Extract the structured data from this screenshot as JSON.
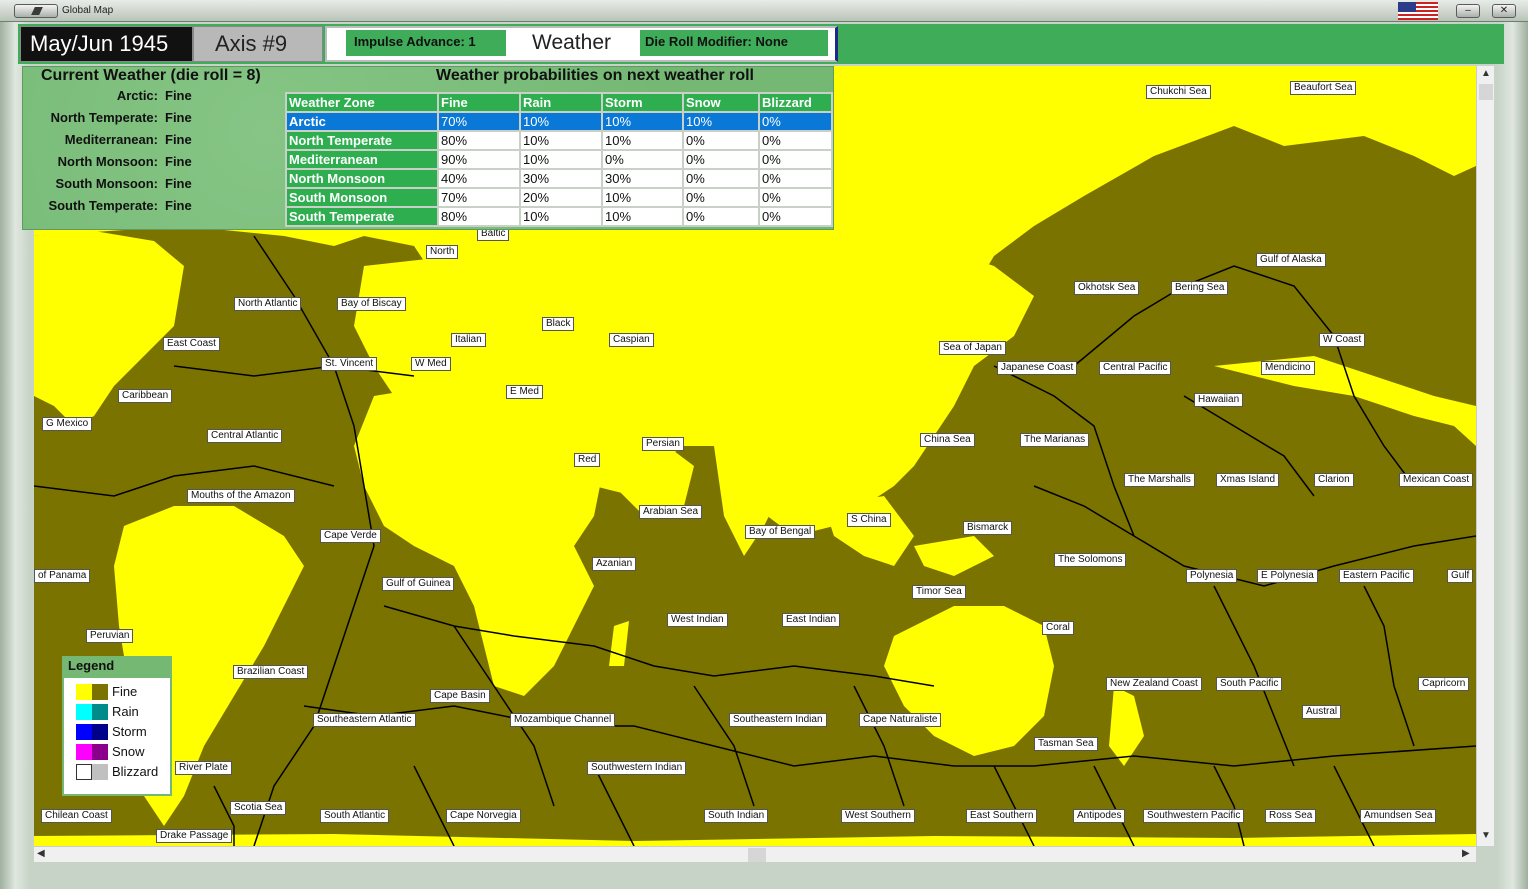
{
  "window": {
    "title": "Global Map"
  },
  "header": {
    "date": "May/Jun 1945",
    "axis": "Axis #9",
    "impulse_advance": "Impulse Advance:  1",
    "weather_label": "Weather",
    "die_roll_modifier": "Die Roll Modifier:  None"
  },
  "current_weather": {
    "title": "Current Weather (die roll = 8)",
    "zones": [
      {
        "name": "Arctic:",
        "value": "Fine"
      },
      {
        "name": "North Temperate:",
        "value": "Fine"
      },
      {
        "name": "Mediterranean:",
        "value": "Fine"
      },
      {
        "name": "North Monsoon:",
        "value": "Fine"
      },
      {
        "name": "South Monsoon:",
        "value": "Fine"
      },
      {
        "name": "South Temperate:",
        "value": "Fine"
      }
    ]
  },
  "probabilities": {
    "title": "Weather probabilities on next weather roll",
    "headers": [
      "Weather Zone",
      "Fine",
      "Rain",
      "Storm",
      "Snow",
      "Blizzard"
    ],
    "rows": [
      [
        "Arctic",
        "70%",
        "10%",
        "10%",
        "10%",
        "0%"
      ],
      [
        "North Temperate",
        "80%",
        "10%",
        "10%",
        "0%",
        "0%"
      ],
      [
        "Mediterranean",
        "90%",
        "10%",
        "0%",
        "0%",
        "0%"
      ],
      [
        "North Monsoon",
        "40%",
        "30%",
        "30%",
        "0%",
        "0%"
      ],
      [
        "South Monsoon",
        "70%",
        "20%",
        "10%",
        "0%",
        "0%"
      ],
      [
        "South Temperate",
        "80%",
        "10%",
        "10%",
        "0%",
        "0%"
      ]
    ],
    "selected_row": "Arctic"
  },
  "legend": {
    "title": "Legend",
    "items": [
      {
        "label": "Fine",
        "land": "#ffff00",
        "sea": "#7a7300"
      },
      {
        "label": "Rain",
        "land": "#00ffff",
        "sea": "#008b8b"
      },
      {
        "label": "Storm",
        "land": "#0000ff",
        "sea": "#00008b"
      },
      {
        "label": "Snow",
        "land": "#ff00ff",
        "sea": "#8b008b"
      },
      {
        "label": "Blizzard",
        "land": "#ffffff",
        "sea": "#c0c0c0"
      }
    ]
  },
  "sea_areas": [
    "Chukchi Sea",
    "Beaufort Sea",
    "Baltic",
    "North",
    "North Atlantic",
    "Bay of Biscay",
    "Black",
    "Caspian",
    "Italian",
    "East Coast",
    "St. Vincent",
    "W Med",
    "E Med",
    "Caribbean",
    "G Mexico",
    "Central Atlantic",
    "Red",
    "Persian",
    "Mouths of the Amazon",
    "Arabian Sea",
    "Cape Verde",
    "Azanian",
    "Gulf of Guinea",
    "Bay of Bengal",
    "S China",
    "of Panama",
    "Peruvian",
    "West Indian",
    "East Indian",
    "Brazilian Coast",
    "Cape Basin",
    "Southeastern Atlantic",
    "Mozambique Channel",
    "Southeastern Indian",
    "Cape Naturaliste",
    "River Plate",
    "Southwestern Indian",
    "Scotia Sea",
    "Chilean Coast",
    "South Atlantic",
    "Cape Norvegia",
    "Drake Passage",
    "South Indian",
    "West Southern",
    "East Southern",
    "Gulf of Alaska",
    "Okhotsk Sea",
    "Bering Sea",
    "W Coast",
    "Sea of Japan",
    "Japanese Coast",
    "Central Pacific",
    "Mendicino",
    "Hawaiian",
    "China Sea",
    "The Marianas",
    "The Marshalls",
    "Xmas Island",
    "Clarion",
    "Mexican Coast",
    "Bismarck",
    "The Solomons",
    "Polynesia",
    "E Polynesia",
    "Eastern Pacific",
    "Gulf",
    "Timor Sea",
    "Coral",
    "New Zealand Coast",
    "South Pacific",
    "Capricorn",
    "Austral",
    "Tasman Sea",
    "Antipodes",
    "Southwestern Pacific",
    "Ross Sea",
    "Amundsen Sea"
  ]
}
